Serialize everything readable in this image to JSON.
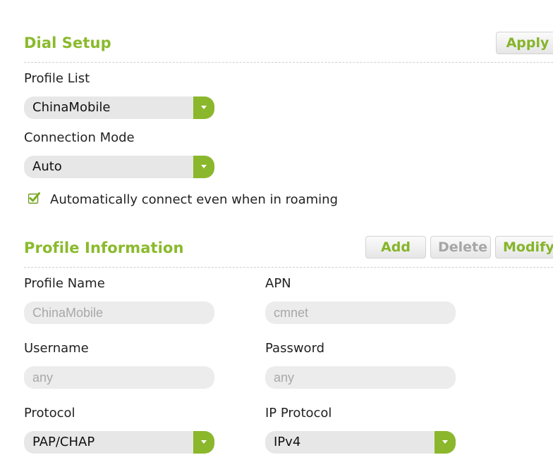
{
  "dial_setup": {
    "title": "Dial Setup",
    "apply_label": "Apply",
    "profile_list_label": "Profile List",
    "profile_list_value": "ChinaMobile",
    "connection_mode_label": "Connection Mode",
    "connection_mode_value": "Auto",
    "roaming_checkbox_label": "Automatically connect even when in roaming",
    "roaming_checked": true
  },
  "profile_info": {
    "title": "Profile Information",
    "add_label": "Add",
    "delete_label": "Delete",
    "modify_label": "Modify",
    "profile_name_label": "Profile Name",
    "profile_name_value": "ChinaMobile",
    "apn_label": "APN",
    "apn_value": "cmnet",
    "username_label": "Username",
    "username_value": "any",
    "password_label": "Password",
    "password_value": "any",
    "protocol_label": "Protocol",
    "protocol_value": "PAP/CHAP",
    "ip_protocol_label": "IP Protocol",
    "ip_protocol_value": "IPv4"
  },
  "colors": {
    "accent": "#8aba2c",
    "muted_button_text": "#a6a6a6",
    "field_bg": "#e7e7e7"
  },
  "icons": {
    "dropdown": "chevron-down-icon",
    "checkbox": "checkmark-icon"
  }
}
